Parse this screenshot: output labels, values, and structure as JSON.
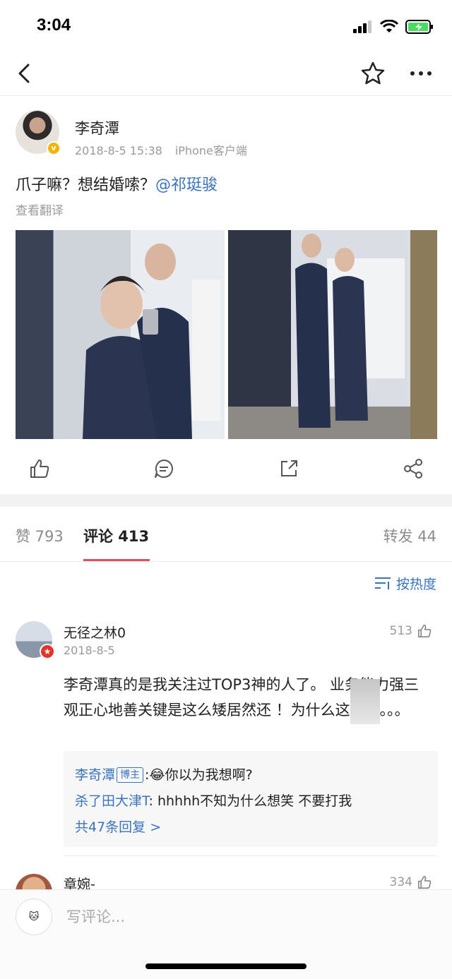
{
  "status_bar": {
    "time": "3:04"
  },
  "post": {
    "author": "李奇潭",
    "date": "2018-8-5 15:38",
    "source": "iPhone客户端",
    "text_plain": "爪子嘛？想结婚嗦？",
    "mention": "@祁珽骏",
    "translate_label": "查看翻译"
  },
  "tabs": {
    "likes": "赞 793",
    "comments": "评论 413",
    "reposts": "转发 44"
  },
  "sort_label": "按热度",
  "comments": [
    {
      "name": "无径之林0",
      "date": "2018-8-5",
      "likes": "513",
      "text": "李奇潭真的是我关注过TOP3神的人了。  业务能力强三观正心地善关键是这么矮居然还    ！为什么这么秀。。。",
      "replies": [
        {
          "name": "李奇潭",
          "tag": "博主",
          "text": ":😂你以为我想啊?"
        },
        {
          "name": "杀了田大津T",
          "text": ": hhhhh不知为什么想笑 不要打我"
        }
      ],
      "more_replies": "共47条回复 >"
    },
    {
      "name": "章婉-",
      "likes": "334"
    }
  ],
  "bottom_bar": {
    "placeholder": "写评论..."
  },
  "colors": {
    "accent_blue": "#3b73c0",
    "tab_underline": "#e3505b",
    "badge_gold": "#f5b400",
    "badge_red": "#e6332a"
  }
}
